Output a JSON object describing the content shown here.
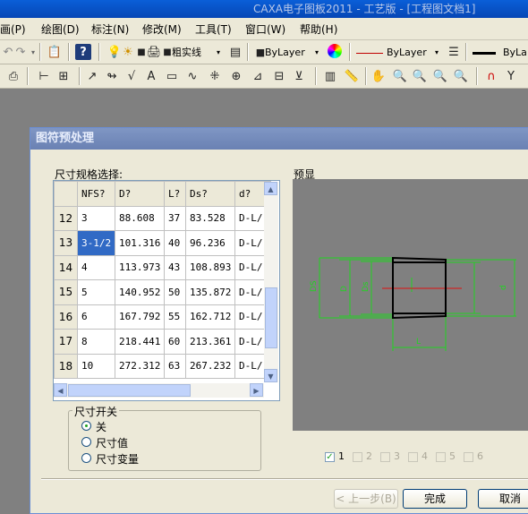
{
  "app": {
    "title": "CAXA电子图板2011 - 工艺版 - [工程图文档1]"
  },
  "menu": {
    "items": [
      "画(P)",
      "绘图(D)",
      "标注(N)",
      "修改(M)",
      "工具(T)",
      "窗口(W)",
      "帮助(H)"
    ]
  },
  "toolbar": {
    "line_type": "粗实线",
    "color_combo": "ByLayer",
    "linetype_combo": "ByLayer",
    "lineweight_combo": "ByLa"
  },
  "dialog": {
    "title": "图符预处理",
    "size_label": "尺寸规格选择:",
    "preview_label": "预显",
    "columns": [
      "NFS?",
      "D?",
      "L?",
      "Ds?",
      "d?"
    ],
    "rows": [
      {
        "num": "12",
        "cells": [
          "3",
          "88.608",
          "37",
          "83.528",
          "D-L/"
        ]
      },
      {
        "num": "13",
        "cells": [
          "3-1/2",
          "101.316",
          "40",
          "96.236",
          "D-L/"
        ]
      },
      {
        "num": "14",
        "cells": [
          "4",
          "113.973",
          "43",
          "108.893",
          "D-L/"
        ]
      },
      {
        "num": "15",
        "cells": [
          "5",
          "140.952",
          "50",
          "135.872",
          "D-L/"
        ]
      },
      {
        "num": "16",
        "cells": [
          "6",
          "167.792",
          "55",
          "162.712",
          "D-L/"
        ]
      },
      {
        "num": "17",
        "cells": [
          "8",
          "218.441",
          "60",
          "213.361",
          "D-L/"
        ]
      },
      {
        "num": "18",
        "cells": [
          "10",
          "272.312",
          "63",
          "267.232",
          "D-L/"
        ]
      }
    ],
    "selected_row": "13",
    "switch_group": {
      "label": "尺寸开关",
      "options": [
        "关",
        "尺寸值",
        "尺寸变量"
      ],
      "selected": "关"
    },
    "preview_views": [
      "1",
      "2",
      "3",
      "4",
      "5",
      "6"
    ],
    "preview_checked": "1",
    "preview_dims": {
      "d1": "DS",
      "d2": "D",
      "d3": "Ds",
      "d4": "d",
      "len": "L"
    },
    "buttons": {
      "prev": "< 上一步(B)",
      "finish": "完成",
      "cancel": "取消"
    },
    "colors": {
      "selection": "#316ac5",
      "dimension": "#21d321",
      "centerline": "#e01010",
      "outline": "#000000"
    }
  }
}
